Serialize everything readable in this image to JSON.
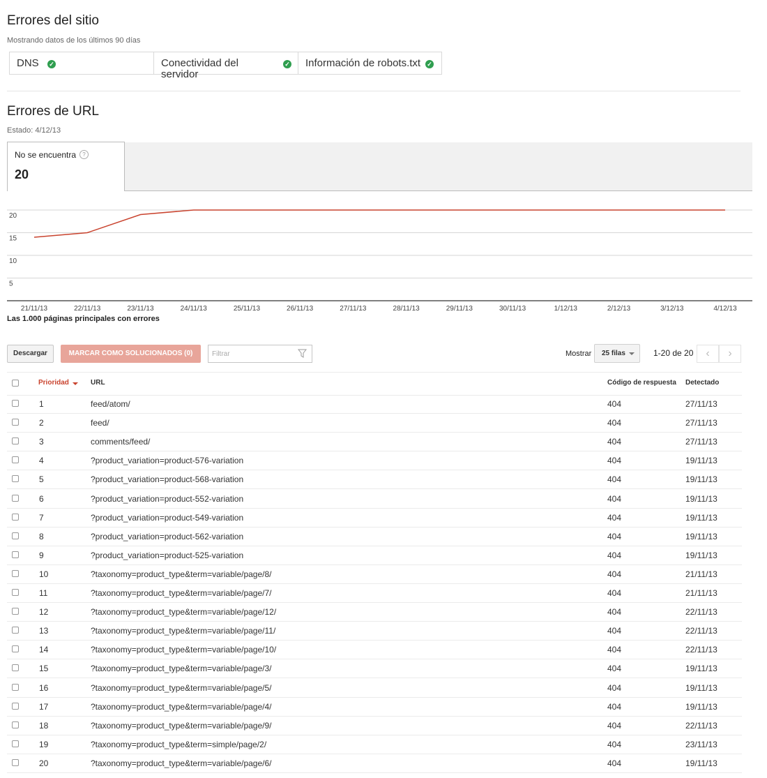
{
  "site_errors": {
    "title": "Errores del sitio",
    "subtitle": "Mostrando datos de los últimos 90 días",
    "items": [
      {
        "label": "DNS"
      },
      {
        "label": "Conectividad del servidor"
      },
      {
        "label": "Información de robots.txt"
      }
    ]
  },
  "url_errors": {
    "title": "Errores de URL",
    "status": "Estado: 4/12/13",
    "tab": {
      "label": "No se encuentra",
      "count": "20"
    }
  },
  "chart_data": {
    "type": "line",
    "x": [
      "21/11/13",
      "22/11/13",
      "23/11/13",
      "24/11/13",
      "25/11/13",
      "26/11/13",
      "27/11/13",
      "28/11/13",
      "29/11/13",
      "30/11/13",
      "1/12/13",
      "2/12/13",
      "3/12/13",
      "4/12/13"
    ],
    "y_ticks": [
      "20",
      "15",
      "10",
      "5"
    ],
    "series": [
      {
        "values": [
          14,
          15,
          19,
          20,
          20,
          20,
          20,
          20,
          20,
          20,
          20,
          20,
          20,
          20
        ],
        "color": "#c9432e"
      }
    ],
    "ylim": [
      0,
      20
    ],
    "grid": true
  },
  "table_caption": "Las 1.000 páginas principales con errores",
  "toolbar": {
    "download": "Descargar",
    "mark_fixed": "MARCAR COMO SOLUCIONADOS (0)",
    "filter_placeholder": "Filtrar",
    "show_label": "Mostrar",
    "rows_select": "25 filas",
    "pagination": "1-20 de 20"
  },
  "table": {
    "headers": {
      "priority": "Prioridad",
      "url": "URL",
      "code": "Código de respuesta",
      "detected": "Detectado"
    },
    "rows": [
      {
        "p": "1",
        "url": "feed/atom/",
        "code": "404",
        "date": "27/11/13"
      },
      {
        "p": "2",
        "url": "feed/",
        "code": "404",
        "date": "27/11/13"
      },
      {
        "p": "3",
        "url": "comments/feed/",
        "code": "404",
        "date": "27/11/13"
      },
      {
        "p": "4",
        "url": "?product_variation=product-576-variation",
        "code": "404",
        "date": "19/11/13"
      },
      {
        "p": "5",
        "url": "?product_variation=product-568-variation",
        "code": "404",
        "date": "19/11/13"
      },
      {
        "p": "6",
        "url": "?product_variation=product-552-variation",
        "code": "404",
        "date": "19/11/13"
      },
      {
        "p": "7",
        "url": "?product_variation=product-549-variation",
        "code": "404",
        "date": "19/11/13"
      },
      {
        "p": "8",
        "url": "?product_variation=product-562-variation",
        "code": "404",
        "date": "19/11/13"
      },
      {
        "p": "9",
        "url": "?product_variation=product-525-variation",
        "code": "404",
        "date": "19/11/13"
      },
      {
        "p": "10",
        "url": "?taxonomy=product_type&term=variable/page/8/",
        "code": "404",
        "date": "21/11/13"
      },
      {
        "p": "11",
        "url": "?taxonomy=product_type&term=variable/page/7/",
        "code": "404",
        "date": "21/11/13"
      },
      {
        "p": "12",
        "url": "?taxonomy=product_type&term=variable/page/12/",
        "code": "404",
        "date": "22/11/13"
      },
      {
        "p": "13",
        "url": "?taxonomy=product_type&term=variable/page/11/",
        "code": "404",
        "date": "22/11/13"
      },
      {
        "p": "14",
        "url": "?taxonomy=product_type&term=variable/page/10/",
        "code": "404",
        "date": "22/11/13"
      },
      {
        "p": "15",
        "url": "?taxonomy=product_type&term=variable/page/3/",
        "code": "404",
        "date": "19/11/13"
      },
      {
        "p": "16",
        "url": "?taxonomy=product_type&term=variable/page/5/",
        "code": "404",
        "date": "19/11/13"
      },
      {
        "p": "17",
        "url": "?taxonomy=product_type&term=variable/page/4/",
        "code": "404",
        "date": "19/11/13"
      },
      {
        "p": "18",
        "url": "?taxonomy=product_type&term=variable/page/9/",
        "code": "404",
        "date": "22/11/13"
      },
      {
        "p": "19",
        "url": "?taxonomy=product_type&term=simple/page/2/",
        "code": "404",
        "date": "23/11/13"
      },
      {
        "p": "20",
        "url": "?taxonomy=product_type&term=variable/page/6/",
        "code": "404",
        "date": "19/11/13"
      }
    ]
  },
  "colors": {
    "accent_red": "#c9432e",
    "ok_green": "#2f9e4f",
    "button_disabled": "#e8a59a"
  }
}
